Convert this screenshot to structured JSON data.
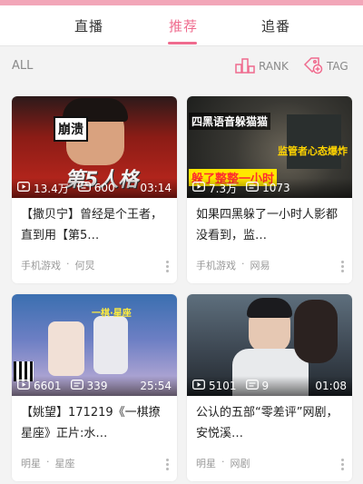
{
  "tabs": [
    {
      "label": "直播"
    },
    {
      "label": "推荐"
    },
    {
      "label": "追番"
    }
  ],
  "filter": {
    "all_label": "ALL",
    "rank_label": "RANK",
    "tag_label": "TAG"
  },
  "colors": {
    "accent": "#ef6b8e",
    "top_strip": "#f2a6b8"
  },
  "cards": [
    {
      "thumb_text_1": "崩溃",
      "thumb_text_2": "第5人格",
      "plays": "13.4万",
      "danmaku": "600",
      "duration": "03:14",
      "title": "【撒贝宁】曾经是个王者，直到用【第5…",
      "category": "手机游戏",
      "uploader": "何炅"
    },
    {
      "thumb_text_1": "四黑语音躲猫猫",
      "thumb_text_2": "监管者心态爆炸",
      "thumb_text_3": "躲了整整一小时",
      "plays": "7.3万",
      "danmaku": "1073",
      "duration": "",
      "title": "如果四黑躲了一小时人影都没看到，监…",
      "category": "手机游戏",
      "uploader": "网易"
    },
    {
      "thumb_text_1": "一棋·星座",
      "plays": "6601",
      "danmaku": "339",
      "duration": "25:54",
      "title": "【姚望】171219《一棋撩星座》正片:水…",
      "category": "明星",
      "uploader": "星座"
    },
    {
      "plays": "5101",
      "danmaku": "9",
      "duration": "01:08",
      "title": "公认的五部“零差评”网剧，安悦溪…",
      "category": "明星",
      "uploader": "网剧"
    }
  ]
}
